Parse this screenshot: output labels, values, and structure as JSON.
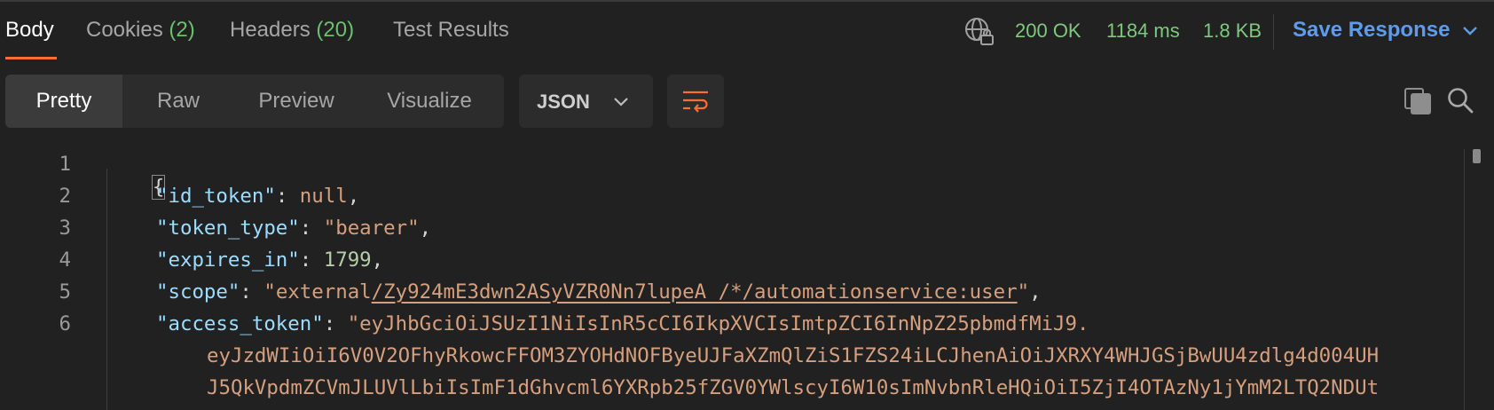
{
  "tabs": [
    {
      "label": "Body",
      "count": ""
    },
    {
      "label": "Cookies",
      "count": "(2)"
    },
    {
      "label": "Headers",
      "count": "(20)"
    },
    {
      "label": "Test Results",
      "count": ""
    }
  ],
  "status": {
    "code": "200 OK",
    "time": "1184 ms",
    "size": "1.8 KB",
    "save_label": "Save Response"
  },
  "view_modes": [
    "Pretty",
    "Raw",
    "Preview",
    "Visualize"
  ],
  "format": "JSON",
  "icons": {
    "globe": "globe-lock-icon",
    "wrap": "wrap-lines-icon",
    "copy": "copy-icon",
    "search": "search-icon"
  },
  "colors": {
    "accent": "#ff6c37",
    "status_ok": "#7fc87f",
    "save": "#5d9cec",
    "json_key": "#9cdcfe",
    "json_string": "#d69f7e",
    "json_number": "#b5cea8"
  },
  "code": {
    "line_numbers": [
      "1",
      "2",
      "3",
      "4",
      "5",
      "6"
    ],
    "open_brace": "{",
    "id_token_key": "\"id_token\"",
    "id_token_value": "null",
    "token_type_key": "\"token_type\"",
    "token_type_value": "\"bearer\"",
    "expires_in_key": "\"expires_in\"",
    "expires_in_value": "1799",
    "scope_key": "\"scope\"",
    "scope_prefix": "\"external",
    "scope_link": "/Zy924mE3dwn2ASyVZR0Nn7lupeA_/*/automationservice:user",
    "scope_suffix": "\"",
    "access_token_key": "\"access_token\"",
    "access_token_line1": "\"eyJhbGciOiJSUzI1NiIsInR5cCI6IkpXVCIsImtpZCI6InNpZ25pbmdfMiJ9.",
    "access_token_line2": "eyJzdWIiOiI6V0V2OFhyRkowcFFOM3ZYOHdNOFByeUJFaXZmQlZiS1FZS24iLCJhenAiOiJXRXY4WHJGSjBwUU4zdlg4d004UH",
    "access_token_line3": "J5QkVpdmZCVmJLUVlLbiIsImF1dGhvcml6YXRpb25fZGV0YWlscyI6W10sImNvbnRleHQiOiI5ZjI4OTAzNy1jYmM2LTQ2NDUt"
  }
}
